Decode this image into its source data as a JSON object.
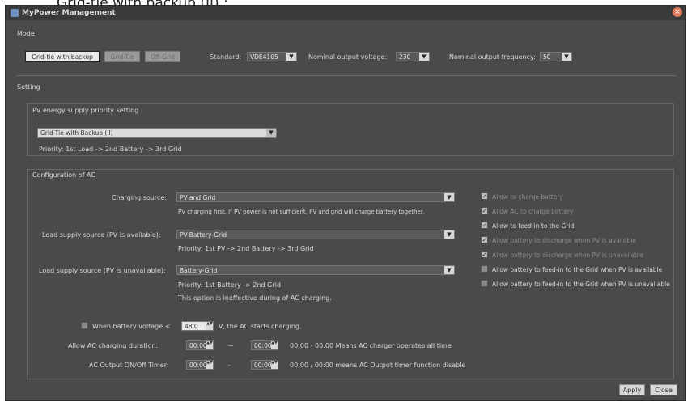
{
  "caption": "Grid-tie with backup (II) :",
  "window": {
    "title": "MyPower Management",
    "close_glyph": "×"
  },
  "mode": {
    "label": "Mode",
    "buttons": [
      "Grid-tie with backup",
      "Grid-Tie",
      "Off-Grid"
    ],
    "standard_label": "Standard:",
    "standard_value": "VDE4105",
    "voltage_label": "Nominal output voltage:",
    "voltage_value": "230",
    "freq_label": "Nominal output frequency:",
    "freq_value": "50"
  },
  "setting_label": "Setting",
  "pv_group": {
    "title": "PV energy supply priority setting",
    "selected": "Grid-Tie with Backup (II)",
    "priority": "Priority: 1st Load -> 2nd Battery -> 3rd Grid"
  },
  "config": {
    "title": "Configuration of AC",
    "charging_label": "Charging source:",
    "charging_value": "PV and Grid",
    "charging_note": "PV charging first. If PV power is not sufficient, PV and grid will charge battery together.",
    "load_avail_label": "Load supply source (PV is available):",
    "load_avail_value": "PV-Battery-Grid",
    "load_avail_note": "Priority: 1st PV -> 2nd Battery -> 3rd Grid",
    "load_unavail_label": "Load supply source (PV is unavailable):",
    "load_unavail_value": "Battery-Grid",
    "load_unavail_note1": "Priority: 1st Battery -> 2nd Grid",
    "load_unavail_note2": "This option is ineffective during of AC charging."
  },
  "options": [
    {
      "label": "Allow to charge battery",
      "checked": true,
      "enabled": false
    },
    {
      "label": "Allow AC to charge battery",
      "checked": true,
      "enabled": false
    },
    {
      "label": "Allow to feed-in to the Grid",
      "checked": true,
      "enabled": true
    },
    {
      "label": "Allow battery to discharge when PV is available",
      "checked": true,
      "enabled": false
    },
    {
      "label": "Allow battery to discharge when PV is unavailable",
      "checked": true,
      "enabled": false
    },
    {
      "label": "Allow battery to feed-in to the Grid when PV is available",
      "checked": false,
      "enabled": true
    },
    {
      "label": "Allow battery to feed-in to the Grid when PV is unavailable",
      "checked": false,
      "enabled": true
    }
  ],
  "bottom": {
    "battery_label": "When battery voltage <",
    "battery_value": "48.0",
    "battery_suffix": "V,  the AC starts charging.",
    "ac_duration_label": "Allow AC charging duration:",
    "ac_start": "00:00",
    "ac_end": "00:00",
    "ac_dash": "~",
    "ac_note": "00:00 - 00:00 Means AC charger operates all time",
    "output_label": "AC Output ON/Off Timer:",
    "out_start": "00:00",
    "out_end": "00:00",
    "out_dash": "-",
    "out_note": "00:00 / 00:00 means AC Output timer function disable"
  },
  "footer": {
    "apply": "Apply",
    "close": "Close"
  }
}
